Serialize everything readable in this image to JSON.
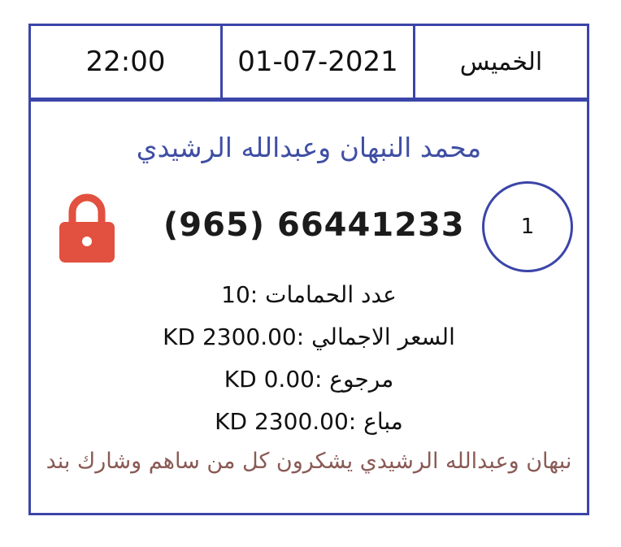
{
  "header": {
    "time": "22:00",
    "date": "01-07-2021",
    "day": "الخميس"
  },
  "customer": {
    "name": "محمد النبهان وعبدالله الرشيدي",
    "phone": "(965) 66441233",
    "index": "1"
  },
  "details": {
    "baths": "عدد الحمامات :10",
    "total": "السعر الاجمالي :KD 2300.00",
    "refund": "مرجوع :KD  0.00",
    "sold": "مباع :KD  2300.00"
  },
  "footer": {
    "thanks": "نبهان وعبدالله الرشيدي يشكرون كل من ساهم وشارك بند"
  },
  "colors": {
    "border": "#3b45a8",
    "name": "#3f4fa4",
    "lock": "#e2503f",
    "thanks": "#8a5a55"
  },
  "icons": {
    "lock": "lock-icon"
  }
}
